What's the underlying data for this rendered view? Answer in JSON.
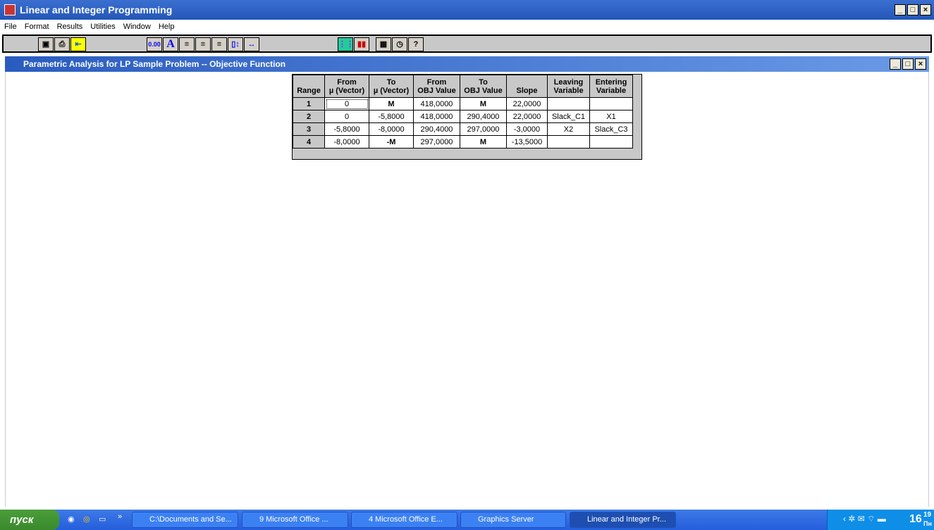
{
  "app": {
    "title": "Linear and Integer Programming"
  },
  "menu": [
    "File",
    "Format",
    "Results",
    "Utilities",
    "Window",
    "Help"
  ],
  "toolbar": {
    "decimal_label": "0.00",
    "font_label": "A"
  },
  "child_window": {
    "title": "Parametric Analysis for LP Sample Problem -- Objective Function"
  },
  "table": {
    "headers": [
      [
        "",
        "Range"
      ],
      [
        "From",
        "µ (Vector)"
      ],
      [
        "To",
        "µ (Vector)"
      ],
      [
        "From",
        "OBJ Value"
      ],
      [
        "To",
        "OBJ Value"
      ],
      [
        "",
        "Slope"
      ],
      [
        "Leaving",
        "Variable"
      ],
      [
        "Entering",
        "Variable"
      ]
    ],
    "rows": [
      [
        "1",
        "0",
        "M",
        "418,0000",
        "M",
        "22,0000",
        "",
        ""
      ],
      [
        "2",
        "0",
        "-5,8000",
        "418,0000",
        "290,4000",
        "22,0000",
        "Slack_C1",
        "X1"
      ],
      [
        "3",
        "-5,8000",
        "-8,0000",
        "290,4000",
        "297,0000",
        "-3,0000",
        "X2",
        "Slack_C3"
      ],
      [
        "4",
        "-8,0000",
        "-M",
        "297,0000",
        "M",
        "-13,5000",
        "",
        ""
      ]
    ]
  },
  "taskbar": {
    "start": "пуск",
    "tasks": [
      "C:\\Documents and Se...",
      "9 Microsoft Office ...",
      "4 Microsoft Office E...",
      "Graphics Server",
      "Linear and Integer Pr..."
    ],
    "clock_hour": "16",
    "clock_min": "19",
    "clock_day": "Пн"
  }
}
